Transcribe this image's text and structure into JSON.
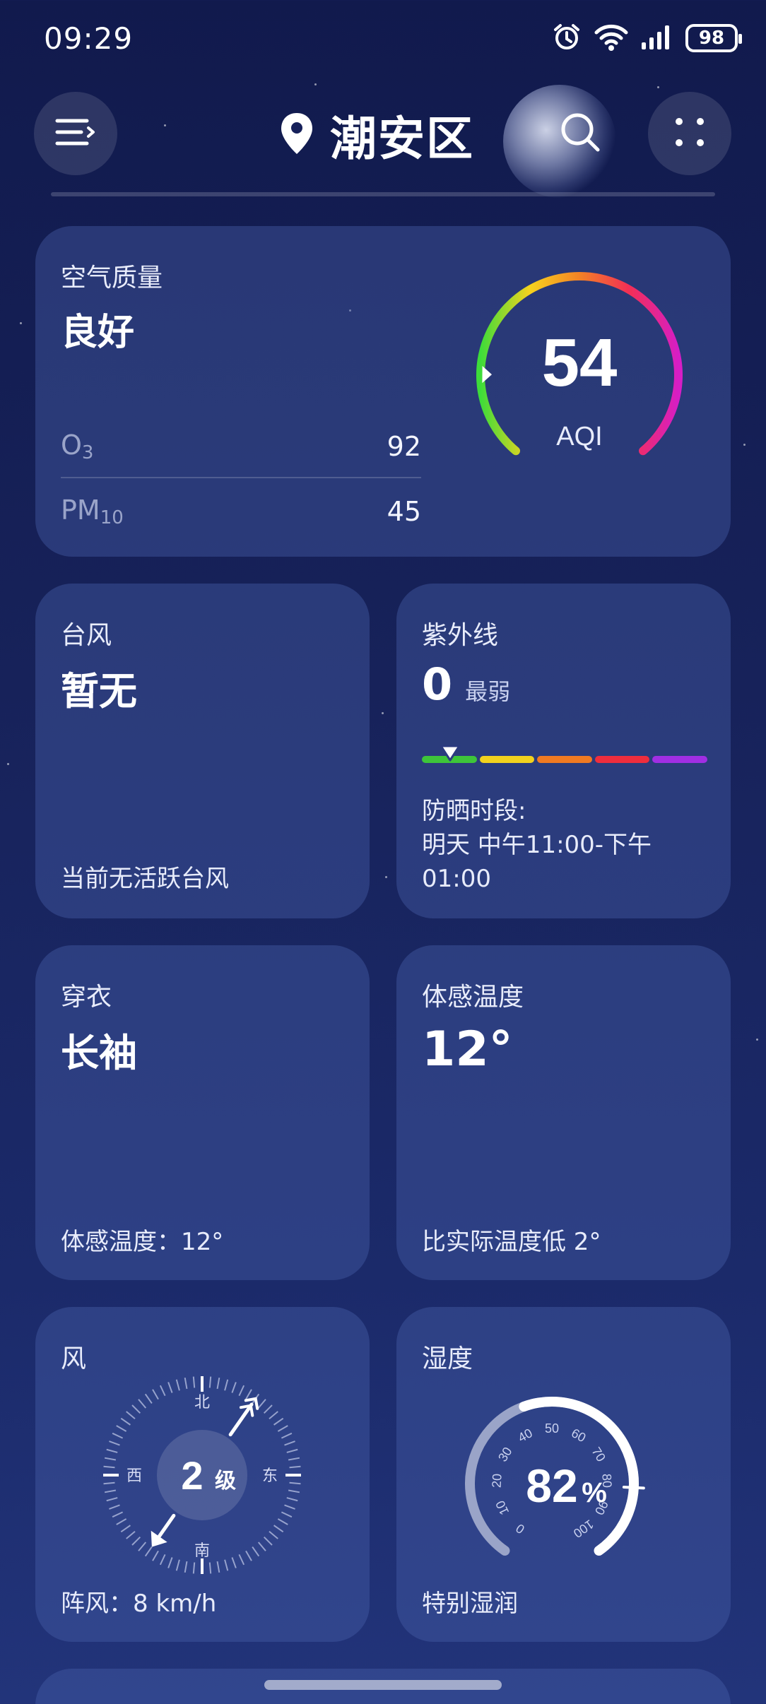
{
  "status_bar": {
    "time": "09:29",
    "battery": "98"
  },
  "header": {
    "city": "潮安区"
  },
  "air_quality": {
    "title": "空气质量",
    "level": "良好",
    "aqi_value": "54",
    "aqi_label": "AQI",
    "aqi_gauge_fraction": 0.18,
    "pollutants": [
      {
        "name": "O",
        "sub": "3",
        "value": "92"
      },
      {
        "name": "PM",
        "sub": "10",
        "value": "45"
      }
    ]
  },
  "typhoon": {
    "title": "台风",
    "status": "暂无",
    "note": "当前无活跃台风"
  },
  "uv": {
    "title": "紫外线",
    "index": "0",
    "level": "最弱",
    "scale_colors": [
      "#3ec53a",
      "#f2d21d",
      "#f07a22",
      "#ef2d3d",
      "#a12ee3"
    ],
    "marker_fraction": 0.1,
    "sun_protect_label": "防晒时段:",
    "sun_protect_time_line1": "明天 中午11:00-下午",
    "sun_protect_time_line2": "01:00"
  },
  "dressing": {
    "title": "穿衣",
    "advice": "长袖",
    "note": "体感温度：12°"
  },
  "feels_like": {
    "title": "体感温度",
    "value": "12°",
    "note": "比实际温度低 2°"
  },
  "wind": {
    "title": "风",
    "level_number": "2",
    "level_unit": "级",
    "direction_labels": {
      "north": "北",
      "south": "南",
      "west": "西",
      "east": "东"
    },
    "direction_degrees": 35,
    "gust": "阵风：8 km/h"
  },
  "humidity": {
    "title": "湿度",
    "value_number": "82",
    "value_unit": "%",
    "percent": 82,
    "ticks": [
      "0",
      "10",
      "20",
      "30",
      "40",
      "50",
      "60",
      "70",
      "80",
      "90",
      "100"
    ],
    "note": "特别湿润"
  },
  "colors": {
    "card_bg": "#3b4f95",
    "aqi_gradient": [
      "#3ddc3a",
      "#f6d21e",
      "#f38225",
      "#f22f55",
      "#d61ec6"
    ],
    "humidity_fill": "#ffffff",
    "humidity_track": "#9aa4c8"
  }
}
